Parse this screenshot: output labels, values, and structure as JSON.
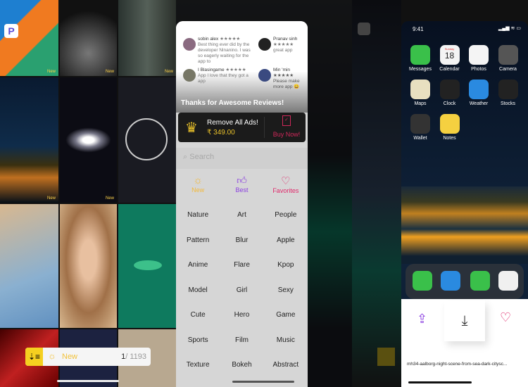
{
  "left_grid": {
    "new_tag": "New",
    "logo_letter": "P"
  },
  "reviews": [
    {
      "name": "sobin alex",
      "stars": "★★★★★",
      "text": "Best thing ever did by the developer Ninanino. I was so eagerly waiting for the app to"
    },
    {
      "name": "Pranav sinh",
      "stars": "★★★★★",
      "text": "great app"
    },
    {
      "name": "I Blasingame",
      "stars": "★★★★★",
      "text": "App I love that they got a app"
    },
    {
      "name": "Min 'min",
      "stars": "★★★★★",
      "text": "Please make more app 😀"
    }
  ],
  "reviews_banner": "Thanks for Awesome Reviews!",
  "ads": {
    "title": "Remove All Ads!",
    "price": "₹ 349.00",
    "buy": "Buy Now!",
    "gold": "#e8c02a",
    "red": "#d0285a"
  },
  "search": {
    "placeholder": "Search"
  },
  "tabs": [
    {
      "label": "New",
      "color": "#f2b93b"
    },
    {
      "label": "Best",
      "color": "#8a3ee0"
    },
    {
      "label": "Favorites",
      "color": "#e0286a"
    }
  ],
  "categories": [
    "Nature",
    "Art",
    "People",
    "Pattern",
    "Blur",
    "Apple",
    "Anime",
    "Flare",
    "Kpop",
    "Model",
    "Girl",
    "Sexy",
    "Cute",
    "Hero",
    "Game",
    "Sports",
    "Film",
    "Music",
    "Texture",
    "Bokeh",
    "Abstract"
  ],
  "bottom_bar": {
    "filter": "New",
    "current": "1",
    "total": "/ 1193"
  },
  "phone": {
    "time": "9:41",
    "apps": [
      "Messages",
      "Calendar",
      "Photos",
      "Camera",
      "Maps",
      "Clock",
      "Weather",
      "Stocks",
      "Wallet",
      "Notes"
    ],
    "calendar_day": "Sunday",
    "calendar_date": "18"
  },
  "sheet": {
    "filename": "mh34-aalborg-night-scene-from-sea-dark-citysc..."
  }
}
